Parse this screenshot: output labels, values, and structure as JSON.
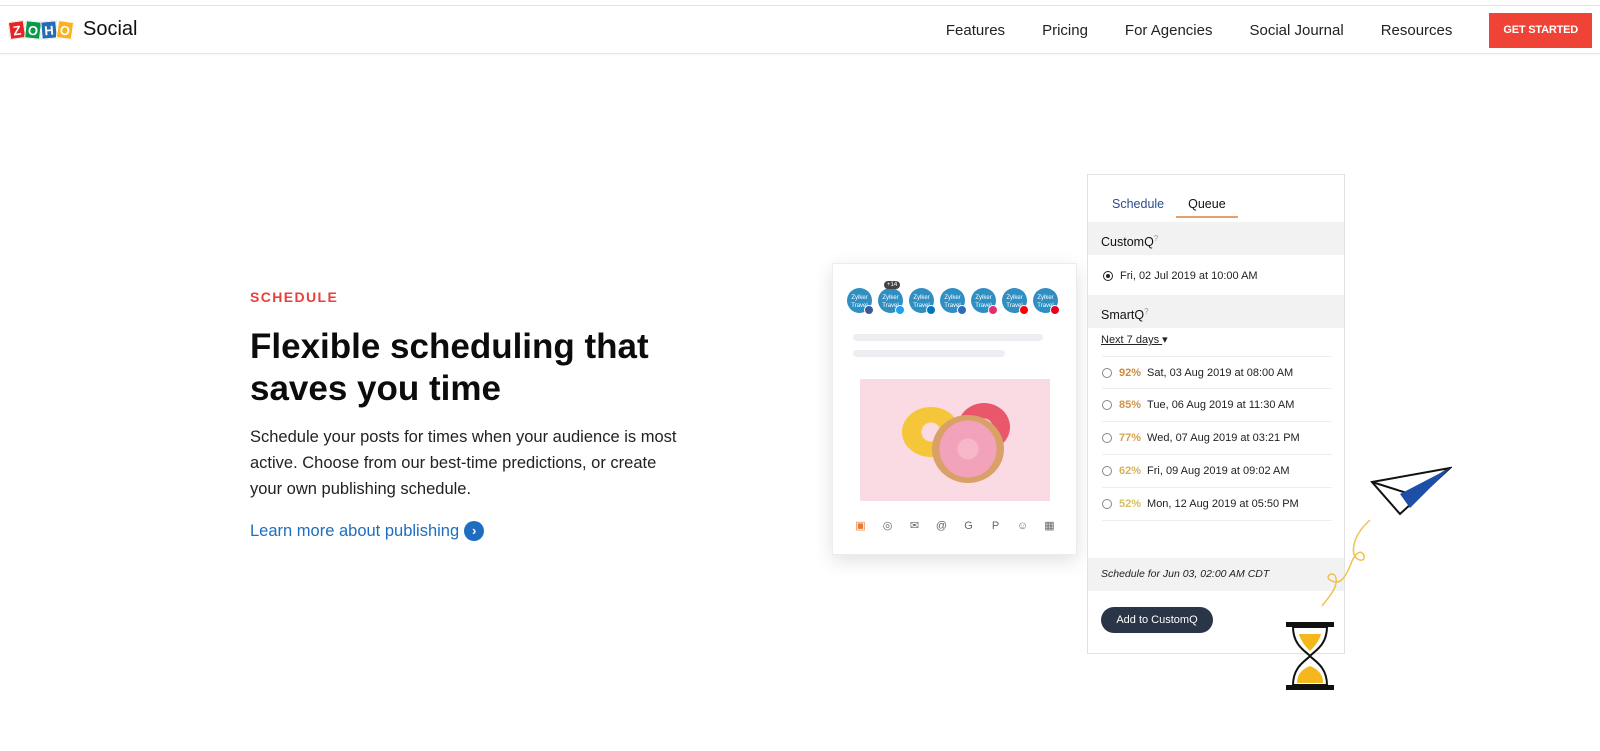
{
  "header": {
    "brand": "Social",
    "nav": [
      "Features",
      "Pricing",
      "For Agencies",
      "Social Journal",
      "Resources"
    ],
    "cta": "GET STARTED"
  },
  "hero": {
    "eyebrow": "SCHEDULE",
    "title": "Flexible scheduling that saves you time",
    "description": "Schedule your posts for times when your audience is most active. Choose from our best-time predictions, or create your own publishing schedule.",
    "link": "Learn more about publishing"
  },
  "compose": {
    "avatar_label": "Zylker Travel",
    "count_badge": "+14",
    "networks": [
      "#3b5998",
      "#1da1f2",
      "#0077b5",
      "#2d6db5",
      "#e1306c",
      "#ff0000",
      "#e60023"
    ]
  },
  "panel": {
    "tabs": [
      "Schedule",
      "Queue"
    ],
    "customq": "CustomQ",
    "customq_slot": "Fri, 02 Jul 2019 at 10:00 AM",
    "smartq": "SmartQ",
    "range": "Next 7 days",
    "slots": [
      {
        "pct": "92%",
        "when": "Sat, 03 Aug 2019 at 08:00 AM",
        "color": "#d08a3e"
      },
      {
        "pct": "85%",
        "when": "Tue, 06 Aug 2019 at 11:30 AM",
        "color": "#d29446"
      },
      {
        "pct": "77%",
        "when": "Wed, 07 Aug 2019 at 03:21 PM",
        "color": "#d3a44e"
      },
      {
        "pct": "62%",
        "when": "Fri, 09 Aug 2019 at 09:02 AM",
        "color": "#d8b257"
      },
      {
        "pct": "52%",
        "when": "Mon, 12 Aug 2019 at 05:50 PM",
        "color": "#d9be5e"
      }
    ],
    "schedule_for": "Schedule for Jun 03, 02:00 AM  CDT",
    "add_button": "Add to CustomQ"
  }
}
